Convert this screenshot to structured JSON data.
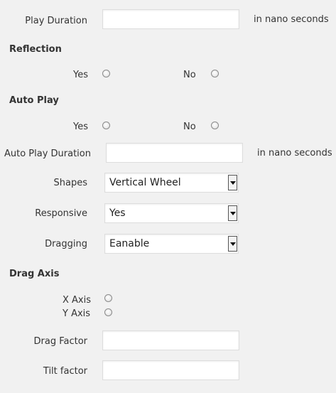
{
  "play_duration": {
    "label": "Play Duration",
    "value": "",
    "hint": "in nano seconds"
  },
  "reflection": {
    "heading": "Reflection",
    "yes_label": "Yes",
    "no_label": "No"
  },
  "auto_play": {
    "heading": "Auto Play",
    "yes_label": "Yes",
    "no_label": "No"
  },
  "auto_play_duration": {
    "label": "Auto Play Duration",
    "value": "",
    "hint": "in nano seconds"
  },
  "shapes": {
    "label": "Shapes",
    "selected": "Vertical Wheel"
  },
  "responsive": {
    "label": "Responsive",
    "selected": "Yes"
  },
  "dragging": {
    "label": "Dragging",
    "selected": "Eanable"
  },
  "drag_axis": {
    "heading": "Drag Axis",
    "x_label": "X Axis",
    "y_label": "Y Axis"
  },
  "drag_factor": {
    "label": "Drag Factor",
    "value": ""
  },
  "tilt_factor": {
    "label": "Tilt factor",
    "value": ""
  },
  "icons": {
    "dropdown": "chevron-down-icon"
  },
  "colors": {
    "background": "#f1f1f1",
    "text": "#333333",
    "input_border": "#dddddd"
  }
}
